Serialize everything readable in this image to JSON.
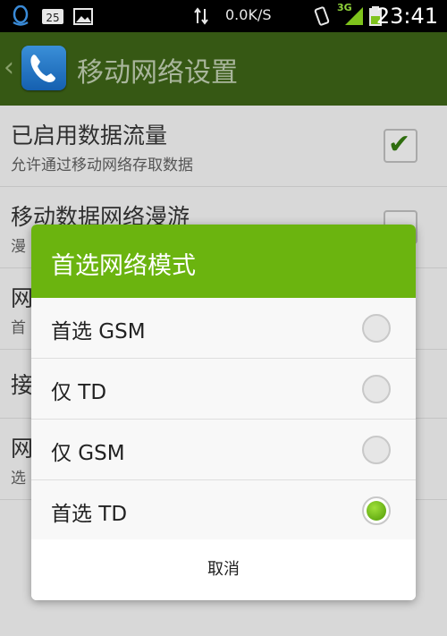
{
  "status_bar": {
    "net_speed": "0.0K/S",
    "signal_type": "3G",
    "time": "23:41",
    "icons": [
      "qq-icon",
      "notification-25-icon",
      "image-icon",
      "data-transfer-icon",
      "vibrate-icon",
      "signal-icon",
      "battery-icon"
    ]
  },
  "action_bar": {
    "back_glyph": "‹",
    "title": "移动网络设置",
    "icon": "phone-icon"
  },
  "settings": {
    "items": [
      {
        "title": "已启用数据流量",
        "subtitle": "允许通过移动网络存取数据",
        "checked": true
      },
      {
        "title": "移动数据网络漫游",
        "subtitle": "漫",
        "checked": false
      },
      {
        "title": "网",
        "subtitle": "首"
      },
      {
        "title": "接",
        "subtitle": ""
      },
      {
        "title": "网",
        "subtitle": "选"
      }
    ]
  },
  "dialog": {
    "title": "首选网络模式",
    "options": [
      {
        "label": "首选 GSM",
        "selected": false
      },
      {
        "label": "仅 TD",
        "selected": false
      },
      {
        "label": "仅 GSM",
        "selected": false
      },
      {
        "label": "首选 TD",
        "selected": true
      }
    ],
    "cancel_label": "取消"
  },
  "colors": {
    "action_bar": "#365814",
    "dialog_header": "#6bb40f",
    "radio_selected": "#6cc017"
  }
}
